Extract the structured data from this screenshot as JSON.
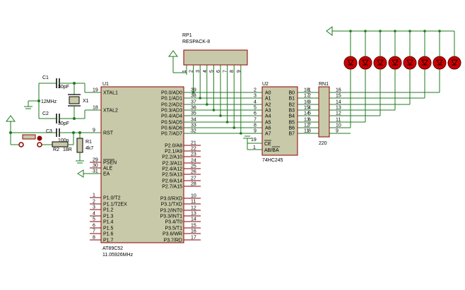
{
  "colors": {
    "wire": "#1f7a1f",
    "body": "#c8c9a8",
    "outline": "#8b0000",
    "led": "#cc0000",
    "junction": "#1f7a1f",
    "text": "#000000"
  },
  "rp1": {
    "ref": "RP1",
    "value": "RESPACK-8",
    "pins": [
      "1",
      "2",
      "3",
      "4",
      "5",
      "6",
      "7",
      "8",
      "9"
    ]
  },
  "u1": {
    "ref": "U1",
    "value": "AT89C52",
    "freq": "11.05926MHz",
    "left_pins": [
      {
        "name": "XTAL1",
        "num": "19"
      },
      {
        "name": "XTAL2",
        "num": "18"
      },
      {
        "name": "RST",
        "num": "9"
      },
      {
        "name": "PSEN",
        "num": "29"
      },
      {
        "name": "ALE",
        "num": "30"
      },
      {
        "name": "EA",
        "num": "31"
      },
      {
        "name": "P1.0/T2",
        "num": "1"
      },
      {
        "name": "P1.1/T2EX",
        "num": "2"
      },
      {
        "name": "P1.2",
        "num": "3"
      },
      {
        "name": "P1.3",
        "num": "4"
      },
      {
        "name": "P1.4",
        "num": "5"
      },
      {
        "name": "P1.5",
        "num": "6"
      },
      {
        "name": "P1.6",
        "num": "7"
      },
      {
        "name": "P1.7",
        "num": "8"
      }
    ],
    "right_pins": [
      {
        "name": "P0.0/AD0",
        "num": "39"
      },
      {
        "name": "P0.1/AD1",
        "num": "38"
      },
      {
        "name": "P0.2/AD2",
        "num": "37"
      },
      {
        "name": "P0.3/AD3",
        "num": "36"
      },
      {
        "name": "P0.4/AD4",
        "num": "35"
      },
      {
        "name": "P0.5/AD5",
        "num": "34"
      },
      {
        "name": "P0.6/AD6",
        "num": "33"
      },
      {
        "name": "P0.7/AD7",
        "num": "32"
      },
      {
        "name": "P2.0/A8",
        "num": "21"
      },
      {
        "name": "P2.1/A9",
        "num": "22"
      },
      {
        "name": "P2.2/A10",
        "num": "23"
      },
      {
        "name": "P2.3/A11",
        "num": "24"
      },
      {
        "name": "P2.4/A12",
        "num": "25"
      },
      {
        "name": "P2.5/A13",
        "num": "26"
      },
      {
        "name": "P2.6/A14",
        "num": "27"
      },
      {
        "name": "P2.7/A15",
        "num": "28"
      },
      {
        "name": "P3.0/RXD",
        "num": "10"
      },
      {
        "name": "P3.1/TXD",
        "num": "11"
      },
      {
        "name": "P3.2/INT0",
        "num": "12"
      },
      {
        "name": "P3.3/INT1",
        "num": "13"
      },
      {
        "name": "P3.4/T0",
        "num": "14"
      },
      {
        "name": "P3.5/T1",
        "num": "15"
      },
      {
        "name": "P3.6/WR",
        "num": "16"
      },
      {
        "name": "P3.7/RD",
        "num": "17"
      }
    ]
  },
  "u2": {
    "ref": "U2",
    "value": "74HC245",
    "a_pins": [
      {
        "name": "A0",
        "num": "2"
      },
      {
        "name": "A1",
        "num": "3"
      },
      {
        "name": "A2",
        "num": "4"
      },
      {
        "name": "A3",
        "num": "5"
      },
      {
        "name": "A4",
        "num": "6"
      },
      {
        "name": "A5",
        "num": "7"
      },
      {
        "name": "A6",
        "num": "8"
      },
      {
        "name": "A7",
        "num": "9"
      }
    ],
    "b_pins": [
      {
        "name": "B0",
        "num": "18"
      },
      {
        "name": "B1",
        "num": "17"
      },
      {
        "name": "B2",
        "num": "16"
      },
      {
        "name": "B3",
        "num": "15"
      },
      {
        "name": "B4",
        "num": "14"
      },
      {
        "name": "B5",
        "num": "13"
      },
      {
        "name": "B6",
        "num": "12"
      },
      {
        "name": "B7",
        "num": "11"
      }
    ],
    "ce": {
      "name": "CE",
      "num": "19"
    },
    "dir": {
      "name": "AB/BA",
      "num": "1"
    }
  },
  "rn1": {
    "ref": "RN1",
    "value": "220",
    "left_nums": [
      "1",
      "2",
      "3",
      "4",
      "5",
      "6",
      "7",
      "8"
    ],
    "right_nums": [
      "16",
      "15",
      "14",
      "13",
      "12",
      "11",
      "10",
      "9"
    ]
  },
  "c1": {
    "ref": "C1",
    "value": "30pF"
  },
  "c2": {
    "ref": "C2",
    "value": "30pF"
  },
  "c3": {
    "ref": "C3",
    "value": "100n"
  },
  "x1": {
    "ref": "X1",
    "value": "12MHz"
  },
  "r1": {
    "ref": "R1",
    "value": "4k7"
  },
  "r2": {
    "ref": "R2",
    "value": "18R"
  },
  "led_count_label": "8"
}
